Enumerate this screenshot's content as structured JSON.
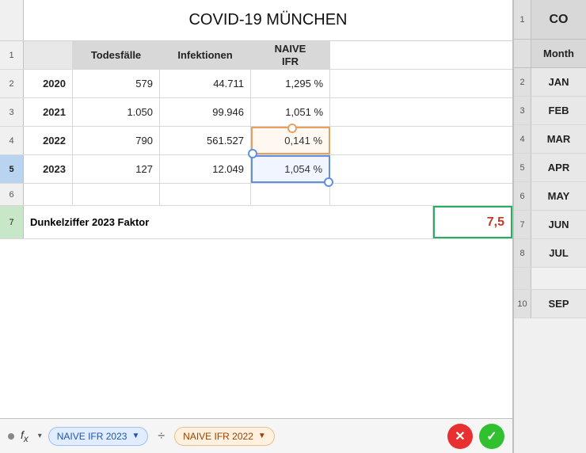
{
  "title": "COVID-19 MÜNCHEN",
  "header": {
    "col_year_label": "",
    "col_todesfaelle": "Todesfälle",
    "col_infektionen": "Infektionen",
    "col_naive_ifr": "NAIVE IFR"
  },
  "rows": [
    {
      "num": "1",
      "year": "",
      "todesfaelle": "Todesfälle",
      "infektionen": "Infektionen",
      "naive_ifr": "NAIVE IFR",
      "is_header": true
    },
    {
      "num": "2",
      "year": "2020",
      "todesfaelle": "579",
      "infektionen": "44.711",
      "naive_ifr": "1,295 %"
    },
    {
      "num": "3",
      "year": "2021",
      "todesfaelle": "1.050",
      "infektionen": "99.946",
      "naive_ifr": "1,051 %"
    },
    {
      "num": "4",
      "year": "2022",
      "todesfaelle": "790",
      "infektionen": "561.527",
      "naive_ifr": "0,141 %",
      "highlight": "orange"
    },
    {
      "num": "5",
      "year": "2023",
      "todesfaelle": "127",
      "infektionen": "12.049",
      "naive_ifr": "1,054 %",
      "highlight": "blue"
    },
    {
      "num": "6",
      "year": "",
      "todesfaelle": "",
      "infektionen": "",
      "naive_ifr": "",
      "empty": true
    }
  ],
  "dunkelziffer_row": {
    "num": "7",
    "label": "Dunkelziffer 2023 Faktor",
    "value": "7,5"
  },
  "formula_bar": {
    "pill1_label": "NAIVE IFR 2023",
    "pill1_chevron": "▼",
    "divider": "÷",
    "pill2_label": "NAIVE IFR 2022",
    "pill2_chevron": "▼",
    "cancel_icon": "✕",
    "confirm_icon": "✓"
  },
  "sidebar": {
    "col_header": "CO",
    "month_header": "Month",
    "row_numbers": [
      "1",
      "2",
      "3",
      "4",
      "5",
      "6",
      "7",
      "8",
      "10"
    ],
    "months": [
      "JAN",
      "FEB",
      "MAR",
      "APR",
      "MAY",
      "JUN",
      "JUL",
      "SEP"
    ]
  }
}
